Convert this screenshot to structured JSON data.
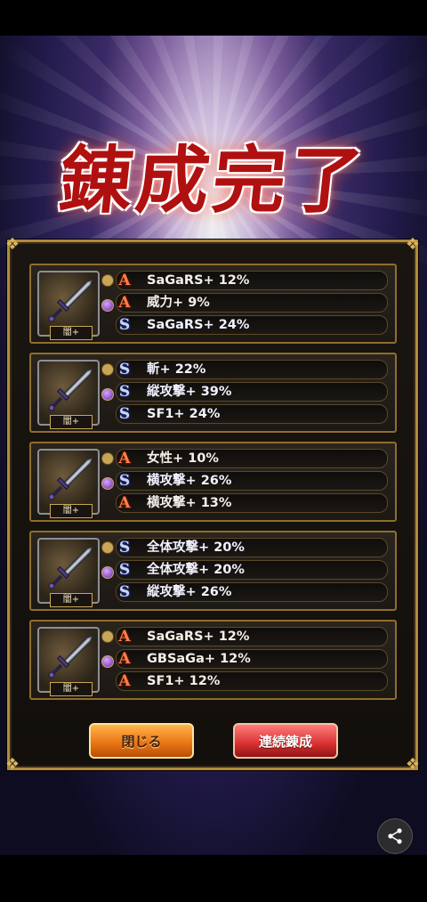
{
  "title": "錬成完了",
  "weapons": [
    {
      "label": "闇+",
      "stats": [
        {
          "type": "A",
          "text": "SaGaRS+ 12%"
        },
        {
          "type": "A",
          "text": "威力+ 9%"
        },
        {
          "type": "S",
          "text": "SaGaRS+ 24%"
        }
      ]
    },
    {
      "label": "闇+",
      "stats": [
        {
          "type": "S",
          "text": "斬+ 22%"
        },
        {
          "type": "S",
          "text": "縦攻撃+ 39%"
        },
        {
          "type": "S",
          "text": "SF1+ 24%"
        }
      ]
    },
    {
      "label": "闇+",
      "stats": [
        {
          "type": "A",
          "text": "女性+ 10%"
        },
        {
          "type": "S",
          "text": "横攻撃+ 26%"
        },
        {
          "type": "A",
          "text": "横攻撃+ 13%"
        }
      ]
    },
    {
      "label": "闇+",
      "stats": [
        {
          "type": "S",
          "text": "全体攻撃+ 20%"
        },
        {
          "type": "S",
          "text": "全体攻撃+ 20%"
        },
        {
          "type": "S",
          "text": "縦攻撃+ 26%"
        }
      ]
    },
    {
      "label": "闇+",
      "stats": [
        {
          "type": "A",
          "text": "SaGaRS+ 12%"
        },
        {
          "type": "A",
          "text": "GBSaGa+ 12%"
        },
        {
          "type": "A",
          "text": "SF1+ 12%"
        }
      ]
    }
  ],
  "buttons": {
    "close": "閉じる",
    "continue": "連続錬成"
  },
  "rank_symbols": {
    "A": "A",
    "S": "S"
  },
  "icons": {
    "share": "share-icon",
    "weapon": "sword-icon"
  }
}
